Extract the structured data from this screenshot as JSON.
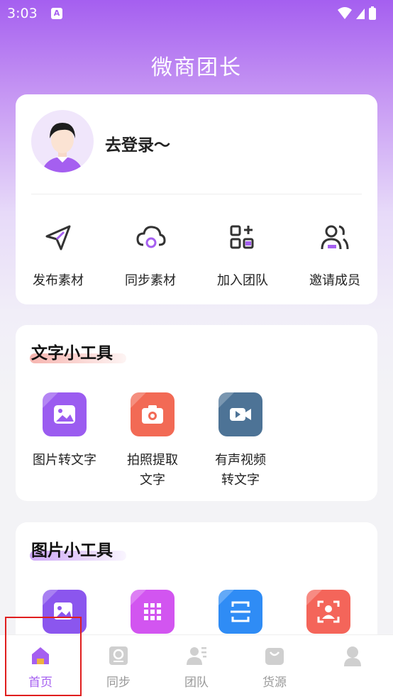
{
  "status_bar": {
    "time": "3:03",
    "notification_badge": "A"
  },
  "app": {
    "title": "微商团长"
  },
  "profile": {
    "login_prompt": "去登录～"
  },
  "actions": [
    {
      "label": "发布素材",
      "icon": "send-icon"
    },
    {
      "label": "同步素材",
      "icon": "cloud-sync-icon"
    },
    {
      "label": "加入团队",
      "icon": "grid-plus-icon"
    },
    {
      "label": "邀请成员",
      "icon": "users-icon"
    }
  ],
  "text_tools": {
    "title": "文字小工具",
    "items": [
      {
        "label": "图片转文字",
        "icon": "image-icon",
        "color": "#9b5cf0"
      },
      {
        "label": "拍照提取文字",
        "icon": "camera-icon",
        "color": "#f26a55"
      },
      {
        "label": "有声视频转文字",
        "icon": "video-icon",
        "color": "#4d7396"
      }
    ]
  },
  "image_tools": {
    "title": "图片小工具",
    "items": [
      {
        "icon": "picture-edit-icon",
        "color": "#8b56ee"
      },
      {
        "icon": "grid-icon",
        "color": "#d255f0"
      },
      {
        "icon": "scan-icon",
        "color": "#2f8cf5"
      },
      {
        "icon": "face-scan-icon",
        "color": "#f4655a"
      }
    ]
  },
  "bottom_nav": [
    {
      "label": "首页",
      "icon": "home-icon",
      "active": true
    },
    {
      "label": "同步",
      "icon": "sync-icon",
      "active": false
    },
    {
      "label": "团队",
      "icon": "team-icon",
      "active": false
    },
    {
      "label": "货源",
      "icon": "bag-icon",
      "active": false
    },
    {
      "label": "",
      "icon": "profile-icon",
      "active": false
    }
  ],
  "colors": {
    "accent": "#a55ff0",
    "highlight_box": "#e01e1e"
  }
}
